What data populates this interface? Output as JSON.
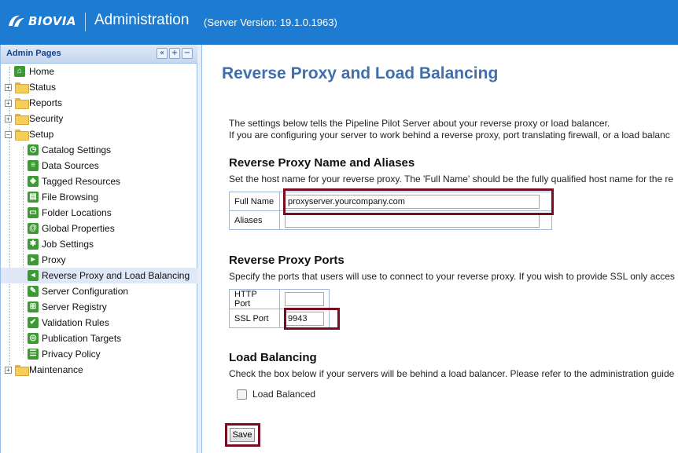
{
  "header": {
    "brand": "BIOVIA",
    "title": "Administration",
    "server_version": "(Server Version: 19.1.0.1963)",
    "bg_color": "#1d7bd1"
  },
  "sidebar": {
    "title": "Admin Pages",
    "tools": [
      "«",
      "+",
      "−"
    ],
    "nodes": [
      {
        "label": "Home",
        "icon": "home-icon"
      },
      {
        "label": "Status",
        "icon": "folder-icon"
      },
      {
        "label": "Reports",
        "icon": "folder-icon"
      },
      {
        "label": "Security",
        "icon": "folder-icon"
      },
      {
        "label": "Setup",
        "icon": "folder-open-icon"
      },
      {
        "label": "Catalog Settings",
        "icon": "clock-icon"
      },
      {
        "label": "Data Sources",
        "icon": "database-icon"
      },
      {
        "label": "Tagged Resources",
        "icon": "tag-icon"
      },
      {
        "label": "File Browsing",
        "icon": "file-icon"
      },
      {
        "label": "Folder Locations",
        "icon": "folder-location-icon"
      },
      {
        "label": "Global Properties",
        "icon": "at-icon"
      },
      {
        "label": "Job Settings",
        "icon": "gear-icon"
      },
      {
        "label": "Proxy",
        "icon": "proxy-icon"
      },
      {
        "label": "Reverse Proxy and Load Balancing",
        "icon": "reverse-proxy-icon"
      },
      {
        "label": "Server Configuration",
        "icon": "wrench-icon"
      },
      {
        "label": "Server Registry",
        "icon": "grid-icon"
      },
      {
        "label": "Validation Rules",
        "icon": "thumb-icon"
      },
      {
        "label": "Publication Targets",
        "icon": "target-icon"
      },
      {
        "label": "Privacy Policy",
        "icon": "document-icon"
      },
      {
        "label": "Maintenance",
        "icon": "folder-icon"
      }
    ]
  },
  "main": {
    "title": "Reverse Proxy and Load Balancing",
    "intro_line1": "The settings below tells the Pipeline Pilot Server about your reverse proxy or load balancer.",
    "intro_line2": "If you are configuring your server to work behind a reverse proxy, port translating firewall, or a load balanc",
    "name_section": {
      "title": "Reverse Proxy Name and Aliases",
      "desc": "Set the host name for your reverse proxy. The 'Full Name' should be the fully qualified host name for the re",
      "full_name_label": "Full Name",
      "full_name_value": "proxyserver.yourcompany.com",
      "aliases_label": "Aliases",
      "aliases_value": ""
    },
    "ports_section": {
      "title": "Reverse Proxy Ports",
      "desc": "Specify the ports that users will use to connect to your reverse proxy. If you wish to provide SSL only acces",
      "http_label": "HTTP Port",
      "http_value": "",
      "ssl_label": "SSL Port",
      "ssl_value": "9943"
    },
    "lb_section": {
      "title": "Load Balancing",
      "desc": "Check the box below if your servers will be behind a load balancer. Please refer to the administration guide",
      "checkbox_label": "Load Balanced"
    },
    "save_label": "Save",
    "highlight_color": "#7a0c22"
  }
}
